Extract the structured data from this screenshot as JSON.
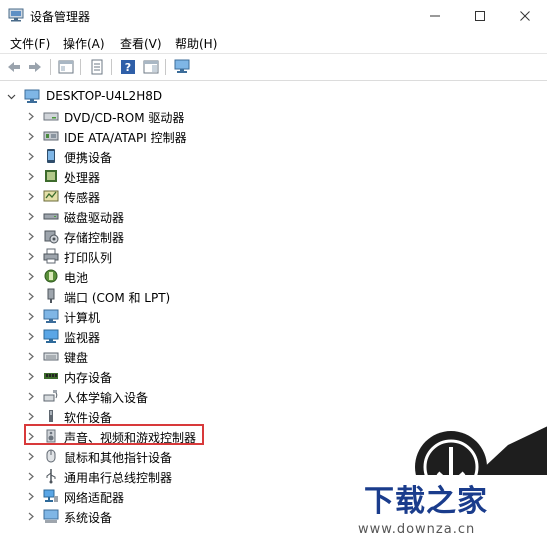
{
  "window": {
    "title": "设备管理器"
  },
  "menu": [
    "文件(F)",
    "操作(A)",
    "查看(V)",
    "帮助(H)"
  ],
  "tree": {
    "root": "DESKTOP-U4L2H8D",
    "items": [
      {
        "label": "DVD/CD-ROM 驱动器",
        "icon": "dvd-drive-icon"
      },
      {
        "label": "IDE ATA/ATAPI 控制器",
        "icon": "ide-controller-icon"
      },
      {
        "label": "便携设备",
        "icon": "portable-device-icon"
      },
      {
        "label": "处理器",
        "icon": "processor-icon"
      },
      {
        "label": "传感器",
        "icon": "sensor-icon"
      },
      {
        "label": "磁盘驱动器",
        "icon": "disk-drive-icon"
      },
      {
        "label": "存储控制器",
        "icon": "storage-controller-icon"
      },
      {
        "label": "打印队列",
        "icon": "printer-icon"
      },
      {
        "label": "电池",
        "icon": "battery-icon"
      },
      {
        "label": "端口 (COM 和 LPT)",
        "icon": "port-icon"
      },
      {
        "label": "计算机",
        "icon": "computer-icon"
      },
      {
        "label": "监视器",
        "icon": "monitor-icon"
      },
      {
        "label": "键盘",
        "icon": "keyboard-icon"
      },
      {
        "label": "内存设备",
        "icon": "memory-icon"
      },
      {
        "label": "人体学输入设备",
        "icon": "hid-icon"
      },
      {
        "label": "软件设备",
        "icon": "software-device-icon"
      },
      {
        "label": "声音、视频和游戏控制器",
        "icon": "speaker-icon"
      },
      {
        "label": "鼠标和其他指针设备",
        "icon": "mouse-icon"
      },
      {
        "label": "通用串行总线控制器",
        "icon": "usb-icon"
      },
      {
        "label": "网络适配器",
        "icon": "network-adapter-icon"
      },
      {
        "label": "系统设备",
        "icon": "system-device-icon"
      }
    ]
  },
  "watermark": {
    "title": "下载之家",
    "url": "www.downza.cn"
  },
  "colors": {
    "highlight": "#d8393a",
    "watermark_blue": "#1a3c8c"
  }
}
